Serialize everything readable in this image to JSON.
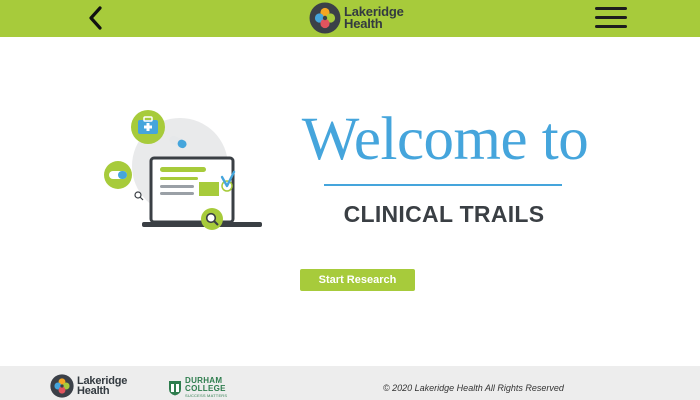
{
  "header": {
    "brand_line1": "Lakeridge",
    "brand_line2": "Health",
    "back_icon": "chevron-left-icon",
    "menu_icon": "hamburger-menu-icon",
    "background_color": "#a7cb3b"
  },
  "hero": {
    "title": "Welcome to",
    "subtitle": "CLINICAL TRAILS",
    "title_color": "#45a5dc",
    "illustration_icon": "laptop-medical-research-icon"
  },
  "actions": {
    "start_label": "Start Research"
  },
  "footer": {
    "brand_line1": "Lakeridge",
    "brand_line2": "Health",
    "college_line1": "DURHAM",
    "college_line2": "COLLEGE",
    "college_tagline": "SUCCESS MATTERS",
    "copyright": "© 2020 Lakeridge Health All Rights Reserved"
  },
  "colors": {
    "accent_green": "#a7cb3b",
    "accent_blue": "#45a5dc",
    "text_dark": "#3a3f44",
    "footer_bg": "#ededed"
  }
}
